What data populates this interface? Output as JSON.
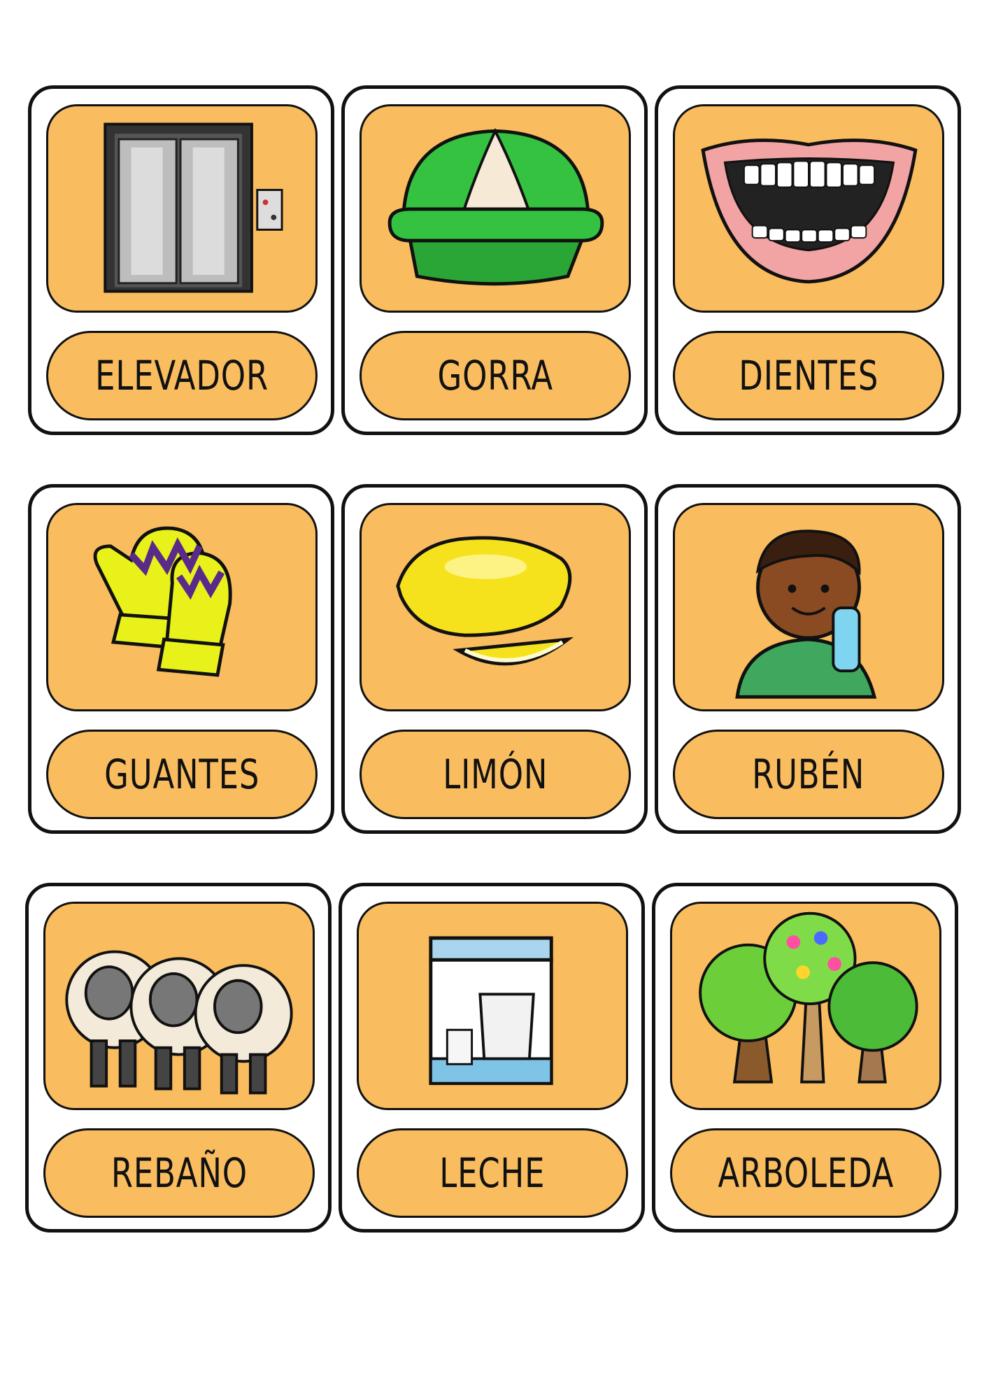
{
  "colors": {
    "card_fill": "#f9bd5f",
    "outline": "#111111",
    "page": "#ffffff"
  },
  "cards": [
    {
      "word": "ELEVADOR",
      "icon": "elevator-icon"
    },
    {
      "word": "GORRA",
      "icon": "cap-icon"
    },
    {
      "word": "DIENTES",
      "icon": "teeth-icon"
    },
    {
      "word": "GUANTES",
      "icon": "mittens-icon"
    },
    {
      "word": "LIMÓN",
      "icon": "lemon-icon"
    },
    {
      "word": "RUBÉN",
      "icon": "boy-icon"
    },
    {
      "word": "REBAÑO",
      "icon": "sheep-flock-icon"
    },
    {
      "word": "LECHE",
      "icon": "milk-icon"
    },
    {
      "word": "ARBOLEDA",
      "icon": "grove-icon"
    }
  ]
}
